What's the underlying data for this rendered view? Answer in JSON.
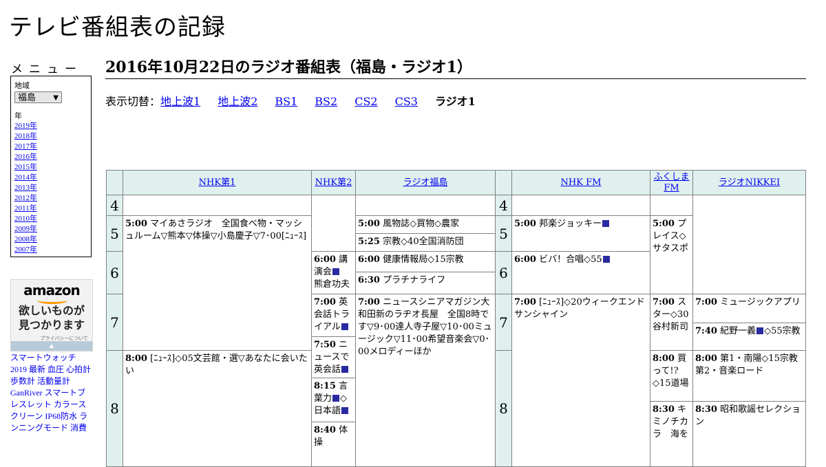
{
  "site": {
    "title": "テレビ番組表の記録"
  },
  "menu": {
    "heading": "メニュー",
    "region_label": "地域",
    "region_value": "福島",
    "year_label": "年",
    "years": [
      "2019年",
      "2018年",
      "2017年",
      "2016年",
      "2015年",
      "2014年",
      "2013年",
      "2012年",
      "2011年",
      "2010年",
      "2009年",
      "2008年",
      "2007年"
    ]
  },
  "ad": {
    "logo": "amazon",
    "text_line1": "欲しいものが",
    "text_line2": "見つかります",
    "privacy": "プライバシーについて",
    "links": [
      "スマートウォッチ",
      "2019 最新 血圧 心拍計",
      "歩数計 活動量計",
      "GanRiver スマートブ",
      "レスレット カラース",
      "クリーン IP68防水 ラ",
      "ンニングモード 消費"
    ]
  },
  "page": {
    "title": "2016年10月22日のラジオ番組表（福島・ラジオ1）",
    "switch_label": "表示切替：",
    "switch_links": [
      "地上波1",
      "地上波2",
      "BS1",
      "BS2",
      "CS2",
      "CS3"
    ],
    "switch_current": "ラジオ1"
  },
  "schedule": {
    "channels": [
      "NHK第1",
      "NHK第2",
      "ラジオ福島",
      "NHK FM",
      "ふくしまFM",
      "ラジオNIKKEI"
    ],
    "hours": [
      "4",
      "5",
      "6",
      "7",
      "8"
    ],
    "programs": [
      {
        "id": "nhk1-500",
        "time": "5:00",
        "title": "マイあさラジオ　全国食べ物・マッシュルーム▽熊本▽体操▽小島慶子▽7･00[ﾆｭｰｽ]"
      },
      {
        "id": "nhk1-800",
        "time": "8:00",
        "title": "[ﾆｭｰｽ]◇05文芸館・選▽あなたに会いたい"
      },
      {
        "id": "nhk2-600",
        "time": "6:00",
        "title": "講演会",
        "title_tail": "　熊倉功夫"
      },
      {
        "id": "nhk2-700",
        "time": "7:00",
        "title": "英会話トライアル"
      },
      {
        "id": "nhk2-750",
        "time": "7:50",
        "title": "ニュースで英会話"
      },
      {
        "id": "nhk2-815",
        "time": "8:15",
        "title": "言葉力",
        "title_tail": "◇日本語"
      },
      {
        "id": "nhk2-840",
        "time": "8:40",
        "title": "体操"
      },
      {
        "id": "rf-500",
        "time": "5:00",
        "title": "風物誌◇買物◇農家"
      },
      {
        "id": "rf-525",
        "time": "5:25",
        "title": "宗教◇40全国消防団"
      },
      {
        "id": "rf-600",
        "time": "6:00",
        "title": "健康情報局◇15宗教"
      },
      {
        "id": "rf-630",
        "time": "6:30",
        "title": "プラチナライフ"
      },
      {
        "id": "rf-700",
        "time": "7:00",
        "title": "ニュースシニアマガジン大和田新のラヂオ長屋　全国8時です▽9･00達人寺子屋▽10･00ミュージック▽11･00希望音楽会▽0･00メロディーほか"
      },
      {
        "id": "fm-500",
        "time": "5:00",
        "title": "邦楽ジョッキー"
      },
      {
        "id": "fm-600",
        "time": "6:00",
        "title": "ビバ！合唱◇55"
      },
      {
        "id": "fm-700",
        "time": "7:00",
        "title": "[ﾆｭｰｽ]◇20ウィークエンドサンシャイン"
      },
      {
        "id": "ffm-500",
        "time": "5:00",
        "title": "プレイス◇サタスポ"
      },
      {
        "id": "ffm-700",
        "time": "7:00",
        "title": "スター◇30谷村新司"
      },
      {
        "id": "ffm-800",
        "time": "8:00",
        "title": "買って!?◇15道場"
      },
      {
        "id": "ffm-830",
        "time": "8:30",
        "title": "キミノチカラ　海を"
      },
      {
        "id": "rn-700",
        "time": "7:00",
        "title": "ミュージックアプリ"
      },
      {
        "id": "rn-740",
        "time": "7:40",
        "title": "紀野一義",
        "title_tail": "◇55宗教"
      },
      {
        "id": "rn-800",
        "time": "8:00",
        "title": "第1・南陽◇15宗教第2・音楽ロード"
      },
      {
        "id": "rn-830",
        "time": "8:30",
        "title": "昭和歌謡セレクション"
      }
    ]
  },
  "colors": {
    "header_bg": "#dff0ef",
    "link": "#0000ee",
    "marker": "#2a2aa0"
  }
}
